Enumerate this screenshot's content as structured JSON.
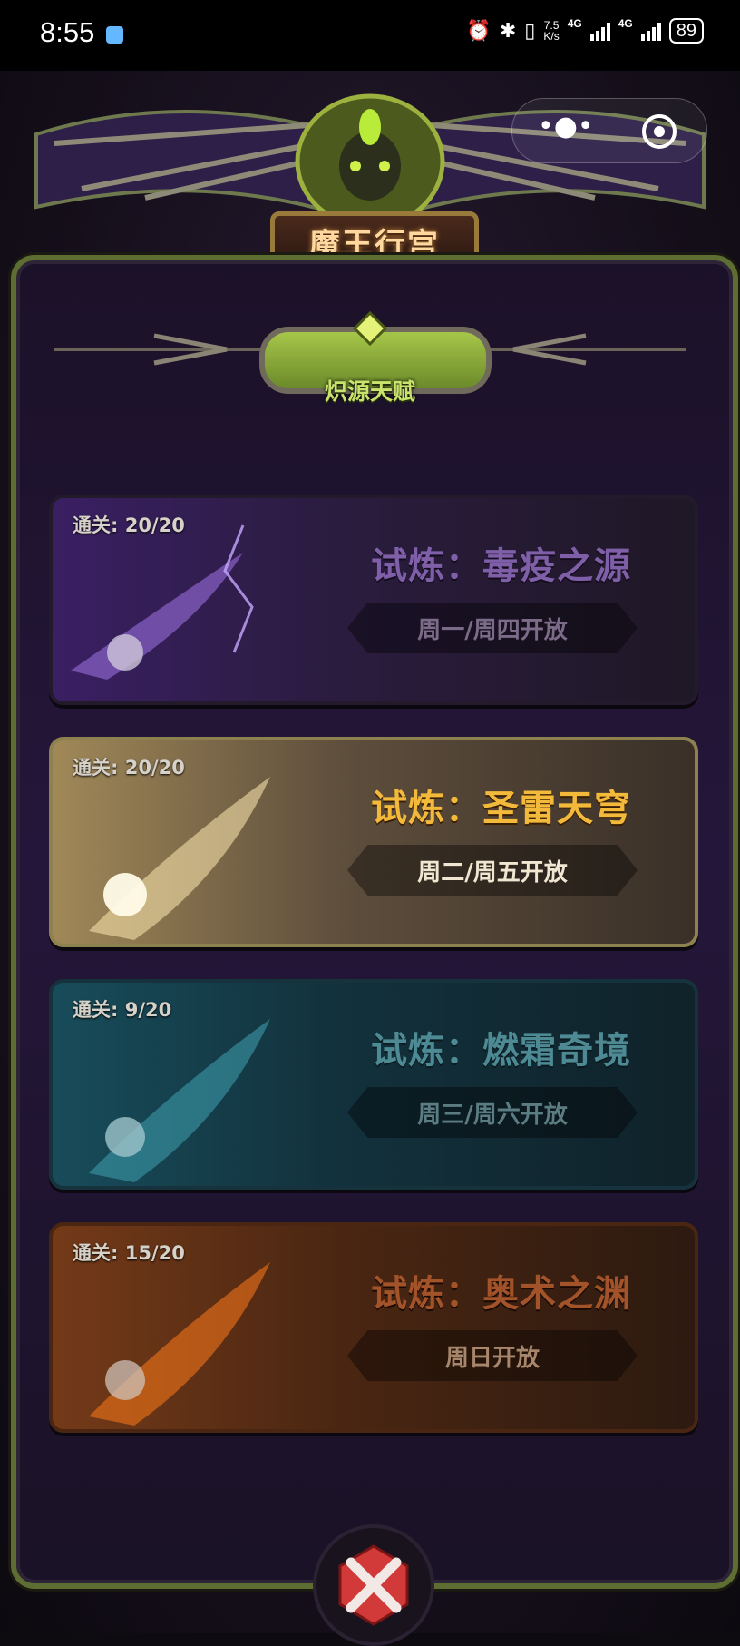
{
  "status_bar": {
    "time": "8:55",
    "speed_value": "7.5",
    "speed_unit": "K/s",
    "network_1": "4G",
    "network_2": "4G",
    "battery": "89",
    "icons": [
      "app-notification-icon",
      "alarm-icon",
      "bluetooth-icon",
      "vibrate-icon",
      "signal-icon",
      "battery-icon"
    ]
  },
  "mini_program": {
    "menu_icon": "more-dots-icon",
    "close_icon": "target-icon"
  },
  "header": {
    "title": "魔王行宫",
    "subtitle": "炽源天赋"
  },
  "trials": [
    {
      "clear_label": "通关: 20/20",
      "title": "试炼：毒疫之源",
      "schedule": "周一/周四开放",
      "theme_color": "#7f5fa7"
    },
    {
      "clear_label": "通关: 20/20",
      "title": "试炼：圣雷天穹",
      "schedule": "周二/周五开放",
      "theme_color": "#f3b93a"
    },
    {
      "clear_label": "通关: 9/20",
      "title": "试炼：燃霜奇境",
      "schedule": "周三/周六开放",
      "theme_color": "#4e8a94"
    },
    {
      "clear_label": "通关: 15/20",
      "title": "试炼：奥术之渊",
      "schedule": "周日开放",
      "theme_color": "#a2532a"
    }
  ],
  "footer": {
    "close_icon": "close-x-icon"
  }
}
